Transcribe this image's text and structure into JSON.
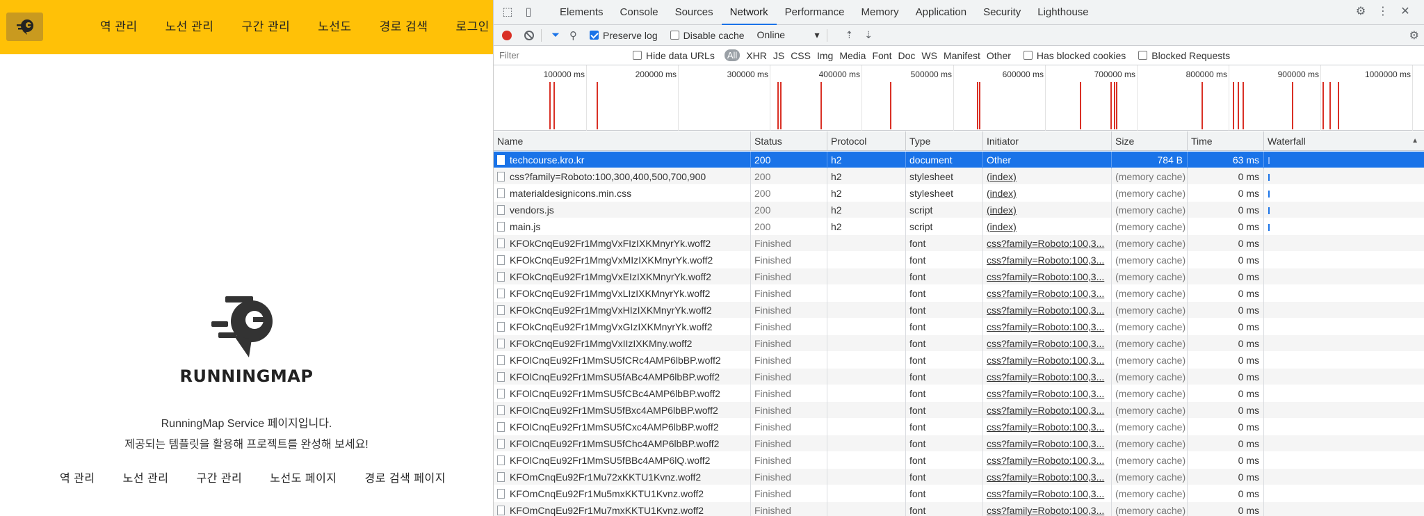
{
  "app": {
    "nav": [
      "역 관리",
      "노선 관리",
      "구간 관리",
      "노선도",
      "경로 검색",
      "로그인"
    ],
    "brand": "RUNNINGMAP",
    "description": [
      "RunningMap Service 페이지입니다.",
      "제공되는 템플릿을 활용해 프로젝트를 완성해 보세요!"
    ],
    "links": [
      "역 관리",
      "노선 관리",
      "구간 관리",
      "노선도 페이지",
      "경로 검색 페이지"
    ],
    "accent_color": "#FFC107"
  },
  "devtools": {
    "tabs": [
      {
        "label": "Elements",
        "active": false
      },
      {
        "label": "Console",
        "active": false
      },
      {
        "label": "Sources",
        "active": false
      },
      {
        "label": "Network",
        "active": true
      },
      {
        "label": "Performance",
        "active": false
      },
      {
        "label": "Memory",
        "active": false
      },
      {
        "label": "Application",
        "active": false
      },
      {
        "label": "Security",
        "active": false
      },
      {
        "label": "Lighthouse",
        "active": false
      }
    ],
    "toolbar": {
      "preserve_log": "Preserve log",
      "disable_cache": "Disable cache",
      "throttling": "Online"
    },
    "filter": {
      "placeholder": "Filter",
      "hide_data_urls": "Hide data URLs",
      "types": [
        "All",
        "XHR",
        "JS",
        "CSS",
        "Img",
        "Media",
        "Font",
        "Doc",
        "WS",
        "Manifest",
        "Other"
      ],
      "has_blocked_cookies": "Has blocked cookies",
      "blocked_requests": "Blocked Requests"
    },
    "overview_labels": [
      "100000 ms",
      "200000 ms",
      "300000 ms",
      "400000 ms",
      "500000 ms",
      "600000 ms",
      "700000 ms",
      "800000 ms",
      "900000 ms",
      "1000000 ms"
    ],
    "columns": [
      "Name",
      "Status",
      "Protocol",
      "Type",
      "Initiator",
      "Size",
      "Time",
      "Waterfall"
    ],
    "rows": [
      {
        "name": "techcourse.kro.kr",
        "status": "200",
        "protocol": "h2",
        "type": "document",
        "initiator": "Other",
        "size": "784 B",
        "time": "63 ms",
        "selected": true,
        "wf": true
      },
      {
        "name": "css?family=Roboto:100,300,400,500,700,900",
        "status": "200",
        "protocol": "h2",
        "type": "stylesheet",
        "initiator": "(index)",
        "size": "(memory cache)",
        "time": "0 ms",
        "wf": true
      },
      {
        "name": "materialdesignicons.min.css",
        "status": "200",
        "protocol": "h2",
        "type": "stylesheet",
        "initiator": "(index)",
        "size": "(memory cache)",
        "time": "0 ms",
        "wf": true
      },
      {
        "name": "vendors.js",
        "status": "200",
        "protocol": "h2",
        "type": "script",
        "initiator": "(index)",
        "size": "(memory cache)",
        "time": "0 ms",
        "wf": true
      },
      {
        "name": "main.js",
        "status": "200",
        "protocol": "h2",
        "type": "script",
        "initiator": "(index)",
        "size": "(memory cache)",
        "time": "0 ms",
        "wf": true
      },
      {
        "name": "KFOkCnqEu92Fr1MmgVxFIzIXKMnyrYk.woff2",
        "status": "Finished",
        "protocol": "",
        "type": "font",
        "initiator": "css?family=Roboto:100,3...",
        "size": "(memory cache)",
        "time": "0 ms"
      },
      {
        "name": "KFOkCnqEu92Fr1MmgVxMIzIXKMnyrYk.woff2",
        "status": "Finished",
        "protocol": "",
        "type": "font",
        "initiator": "css?family=Roboto:100,3...",
        "size": "(memory cache)",
        "time": "0 ms"
      },
      {
        "name": "KFOkCnqEu92Fr1MmgVxEIzIXKMnyrYk.woff2",
        "status": "Finished",
        "protocol": "",
        "type": "font",
        "initiator": "css?family=Roboto:100,3...",
        "size": "(memory cache)",
        "time": "0 ms"
      },
      {
        "name": "KFOkCnqEu92Fr1MmgVxLIzIXKMnyrYk.woff2",
        "status": "Finished",
        "protocol": "",
        "type": "font",
        "initiator": "css?family=Roboto:100,3...",
        "size": "(memory cache)",
        "time": "0 ms"
      },
      {
        "name": "KFOkCnqEu92Fr1MmgVxHIzIXKMnyrYk.woff2",
        "status": "Finished",
        "protocol": "",
        "type": "font",
        "initiator": "css?family=Roboto:100,3...",
        "size": "(memory cache)",
        "time": "0 ms"
      },
      {
        "name": "KFOkCnqEu92Fr1MmgVxGIzIXKMnyrYk.woff2",
        "status": "Finished",
        "protocol": "",
        "type": "font",
        "initiator": "css?family=Roboto:100,3...",
        "size": "(memory cache)",
        "time": "0 ms"
      },
      {
        "name": "KFOkCnqEu92Fr1MmgVxIIzIXKMny.woff2",
        "status": "Finished",
        "protocol": "",
        "type": "font",
        "initiator": "css?family=Roboto:100,3...",
        "size": "(memory cache)",
        "time": "0 ms"
      },
      {
        "name": "KFOlCnqEu92Fr1MmSU5fCRc4AMP6lbBP.woff2",
        "status": "Finished",
        "protocol": "",
        "type": "font",
        "initiator": "css?family=Roboto:100,3...",
        "size": "(memory cache)",
        "time": "0 ms"
      },
      {
        "name": "KFOlCnqEu92Fr1MmSU5fABc4AMP6lbBP.woff2",
        "status": "Finished",
        "protocol": "",
        "type": "font",
        "initiator": "css?family=Roboto:100,3...",
        "size": "(memory cache)",
        "time": "0 ms"
      },
      {
        "name": "KFOlCnqEu92Fr1MmSU5fCBc4AMP6lbBP.woff2",
        "status": "Finished",
        "protocol": "",
        "type": "font",
        "initiator": "css?family=Roboto:100,3...",
        "size": "(memory cache)",
        "time": "0 ms"
      },
      {
        "name": "KFOlCnqEu92Fr1MmSU5fBxc4AMP6lbBP.woff2",
        "status": "Finished",
        "protocol": "",
        "type": "font",
        "initiator": "css?family=Roboto:100,3...",
        "size": "(memory cache)",
        "time": "0 ms"
      },
      {
        "name": "KFOlCnqEu92Fr1MmSU5fCxc4AMP6lbBP.woff2",
        "status": "Finished",
        "protocol": "",
        "type": "font",
        "initiator": "css?family=Roboto:100,3...",
        "size": "(memory cache)",
        "time": "0 ms"
      },
      {
        "name": "KFOlCnqEu92Fr1MmSU5fChc4AMP6lbBP.woff2",
        "status": "Finished",
        "protocol": "",
        "type": "font",
        "initiator": "css?family=Roboto:100,3...",
        "size": "(memory cache)",
        "time": "0 ms"
      },
      {
        "name": "KFOlCnqEu92Fr1MmSU5fBBc4AMP6lQ.woff2",
        "status": "Finished",
        "protocol": "",
        "type": "font",
        "initiator": "css?family=Roboto:100,3...",
        "size": "(memory cache)",
        "time": "0 ms"
      },
      {
        "name": "KFOmCnqEu92Fr1Mu72xKKTU1Kvnz.woff2",
        "status": "Finished",
        "protocol": "",
        "type": "font",
        "initiator": "css?family=Roboto:100,3...",
        "size": "(memory cache)",
        "time": "0 ms"
      },
      {
        "name": "KFOmCnqEu92Fr1Mu5mxKKTU1Kvnz.woff2",
        "status": "Finished",
        "protocol": "",
        "type": "font",
        "initiator": "css?family=Roboto:100,3...",
        "size": "(memory cache)",
        "time": "0 ms"
      },
      {
        "name": "KFOmCnqEu92Fr1Mu7mxKKTU1Kvnz.woff2",
        "status": "Finished",
        "protocol": "",
        "type": "font",
        "initiator": "css?family=Roboto:100,3...",
        "size": "(memory cache)",
        "time": "0 ms"
      }
    ]
  }
}
